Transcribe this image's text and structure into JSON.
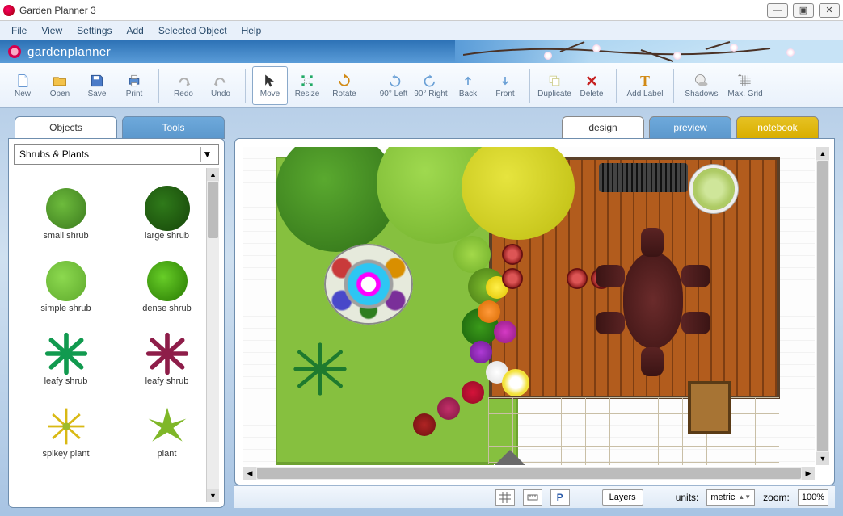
{
  "window": {
    "title": "Garden Planner 3"
  },
  "menu": {
    "file": "File",
    "view": "View",
    "settings": "Settings",
    "add": "Add",
    "selected": "Selected Object",
    "help": "Help"
  },
  "brand": "gardenplanner",
  "toolbar": {
    "new": "New",
    "open": "Open",
    "save": "Save",
    "print": "Print",
    "redo": "Redo",
    "undo": "Undo",
    "move": "Move",
    "resize": "Resize",
    "rotate": "Rotate",
    "rot_left": "90° Left",
    "rot_right": "90° Right",
    "back": "Back",
    "front": "Front",
    "duplicate": "Duplicate",
    "delete": "Delete",
    "add_label": "Add Label",
    "shadows": "Shadows",
    "max_grid": "Max. Grid"
  },
  "sidebar": {
    "tabs": {
      "objects": "Objects",
      "tools": "Tools"
    },
    "category": "Shrubs & Plants",
    "items": [
      {
        "label": "small shrub"
      },
      {
        "label": "large shrub"
      },
      {
        "label": "simple shrub"
      },
      {
        "label": "dense shrub"
      },
      {
        "label": "leafy shrub"
      },
      {
        "label": "leafy shrub"
      },
      {
        "label": "spikey plant"
      },
      {
        "label": "plant"
      }
    ]
  },
  "designTabs": {
    "design": "design",
    "preview": "preview",
    "notebook": "notebook"
  },
  "status": {
    "layers": "Layers",
    "units_label": "units:",
    "units_value": "metric",
    "zoom_label": "zoom:",
    "zoom_value": "100%",
    "p_button": "P"
  }
}
